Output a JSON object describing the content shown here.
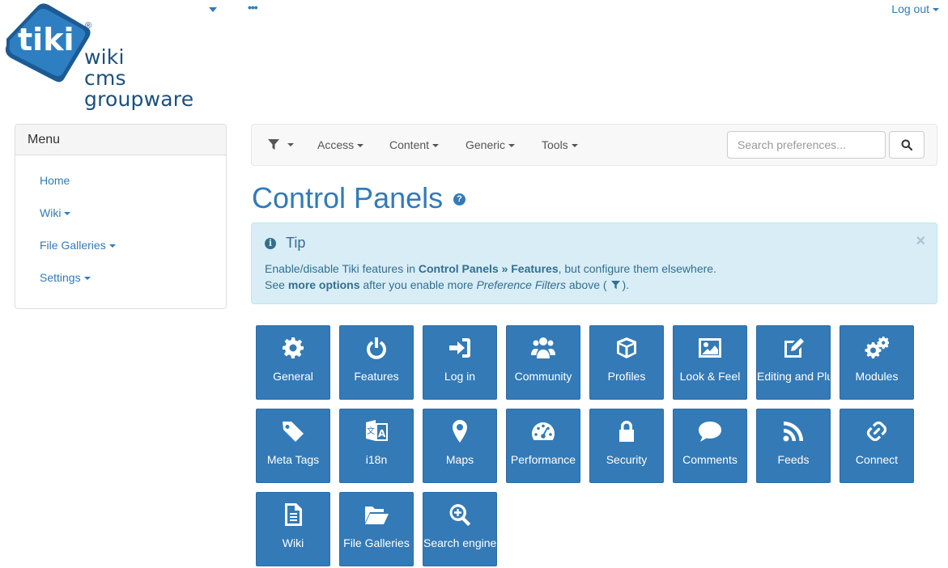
{
  "header": {
    "logout_label": "Log out",
    "logo_mark": "tiki",
    "logo_lines": [
      "wiki",
      "cms",
      "groupware"
    ],
    "registered": "®"
  },
  "sidebar": {
    "title": "Menu",
    "items": [
      {
        "label": "Home",
        "dropdown": false
      },
      {
        "label": "Wiki",
        "dropdown": true
      },
      {
        "label": "File Galleries",
        "dropdown": true
      },
      {
        "label": "Settings",
        "dropdown": true
      }
    ]
  },
  "navbar": {
    "items": [
      "Access",
      "Content",
      "Generic",
      "Tools"
    ],
    "search_placeholder": "Search preferences..."
  },
  "page": {
    "title": "Control Panels",
    "help": "?"
  },
  "tip": {
    "title": "Tip",
    "close": "×",
    "line1_a": "Enable/disable Tiki features in ",
    "line1_b": "Control Panels » Features",
    "line1_c": ", but configure them elsewhere.",
    "line2_a": "See ",
    "line2_b": "more options",
    "line2_c": " after you enable more ",
    "line2_d": "Preference Filters",
    "line2_e": " above (",
    "line2_f": ")."
  },
  "panels": [
    {
      "label": "General",
      "icon": "gear-icon"
    },
    {
      "label": "Features",
      "icon": "power-icon"
    },
    {
      "label": "Log in",
      "icon": "sign-in-icon"
    },
    {
      "label": "Community",
      "icon": "users-icon"
    },
    {
      "label": "Profiles",
      "icon": "cube-icon"
    },
    {
      "label": "Look & Feel",
      "icon": "image-icon"
    },
    {
      "label": "Editing and Plugins",
      "icon": "edit-icon"
    },
    {
      "label": "Modules",
      "icon": "gears-icon"
    },
    {
      "label": "Meta Tags",
      "icon": "tag-icon"
    },
    {
      "label": "i18n",
      "icon": "language-icon"
    },
    {
      "label": "Maps",
      "icon": "map-marker-icon"
    },
    {
      "label": "Performance",
      "icon": "dashboard-icon"
    },
    {
      "label": "Security",
      "icon": "lock-icon"
    },
    {
      "label": "Comments",
      "icon": "comment-icon"
    },
    {
      "label": "Feeds",
      "icon": "rss-icon"
    },
    {
      "label": "Connect",
      "icon": "link-icon"
    },
    {
      "label": "Wiki",
      "icon": "file-text-icon"
    },
    {
      "label": "File Galleries",
      "icon": "folder-open-icon"
    },
    {
      "label": "Search engine",
      "icon": "search-plus-icon"
    }
  ],
  "colors": {
    "primary": "#337ab7",
    "tip_bg": "#d9edf7",
    "tip_text": "#31708f",
    "logo": "#1c4f7f"
  }
}
